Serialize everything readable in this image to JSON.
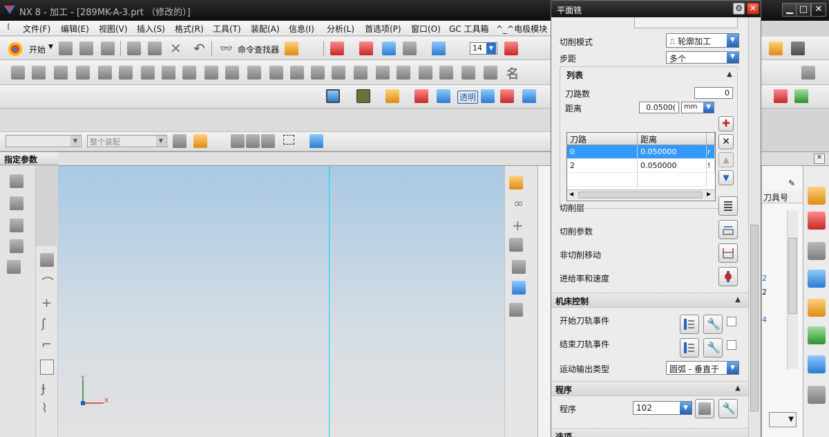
{
  "window": {
    "title": "NX 8 - 加工 - [289MK-A-3.prt （修改的）]"
  },
  "menubar": {
    "items": [
      "文件(F)",
      "编辑(E)",
      "视图(V)",
      "插入(S)",
      "格式(R)",
      "工具(T)",
      "装配(A)",
      "信息(I)",
      "分析(L)",
      "首选项(P)",
      "窗口(O)",
      "GC 工具箱",
      "^_^电极模块"
    ]
  },
  "toolbar_main": {
    "start_label": "开始",
    "command_finder_label": "命令查找器",
    "font_size": "14"
  },
  "toolbar_misc": {
    "transparent_label": "透明",
    "selection_placeholder": "",
    "assembly_label": "整个装配"
  },
  "left_panel": {
    "title": "指定参数"
  },
  "axes": {
    "x_label": "X",
    "y_label": "Y"
  },
  "dialog": {
    "title": "平面铣",
    "cut_mode_label": "切削模式",
    "cut_mode_value": "轮廓加工",
    "stepover_label": "步距",
    "stepover_value": "多个",
    "list_section": "列表",
    "path_count_label": "刀路数",
    "path_count_value": "0",
    "distance_label": "距离",
    "distance_value": "0.0500(",
    "distance_unit": "mm",
    "table": {
      "headers": [
        "刀路",
        "距离"
      ],
      "rows": [
        {
          "path": "0",
          "distance": "0.050000",
          "extra": "r"
        },
        {
          "path": "2",
          "distance": "0.050000",
          "extra": "!"
        }
      ]
    },
    "cut_levels_label": "切削层",
    "cut_params_label": "切削参数",
    "non_cut_moves_label": "非切削移动",
    "feeds_speeds_label": "进给率和速度",
    "machine_control_section": "机床控制",
    "start_event_label": "开始刀轨事件",
    "end_event_label": "结束刀轨事件",
    "motion_output_label": "运动输出类型",
    "motion_output_value": "圆弧 - 垂直于",
    "program_section": "程序",
    "program_label": "程序",
    "program_value": "102",
    "options_section": "选项"
  },
  "navigator": {
    "tool_number_header": "刀具号",
    "values": [
      "2",
      "2",
      "4"
    ]
  },
  "colors": {
    "titlebar": "#1a1a1a",
    "selection": "#3399ff",
    "viewport_top": "#a9c9e3",
    "axis_line": "#00d8ff"
  }
}
